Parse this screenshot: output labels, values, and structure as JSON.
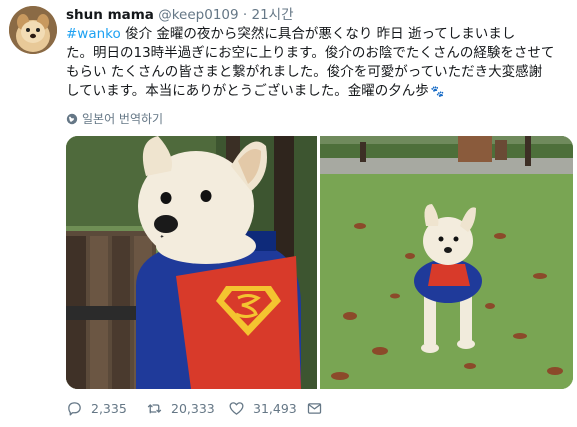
{
  "user": {
    "name": "shun mama",
    "handle": "@keep0109",
    "separator": "·",
    "time": "21시간"
  },
  "tweet": {
    "hashtag": "#wanko",
    "line1_rest": " 俊介 金曜の夜から突然に具合が悪くなり 昨日 逝ってしまいまし",
    "line2": "た。明日の13時半過ぎにお空に上ります。俊介のお陰でたくさんの経験をさせて",
    "line3": "もらい たくさんの皆さまと繋がれました。俊介を可愛がっていただき大変感謝",
    "line4": "しています。本当にありがとうございました。金曜の夕ん歩",
    "emoji": "🐾"
  },
  "translate": {
    "label": "일본어 번역하기",
    "icon": "globe-icon"
  },
  "media": {
    "photos": [
      {
        "name": "photo-dog-superman-bench"
      },
      {
        "name": "photo-dog-superman-lawn"
      }
    ]
  },
  "actions": {
    "reply_count": "2,335",
    "retweet_count": "20,333",
    "like_count": "31,493",
    "reply_icon": "reply-icon",
    "retweet_icon": "retweet-icon",
    "like_icon": "heart-icon",
    "dm_icon": "envelope-icon"
  },
  "colors": {
    "hashtag": "#1da1f2",
    "muted": "#657786",
    "text": "#14171a"
  }
}
